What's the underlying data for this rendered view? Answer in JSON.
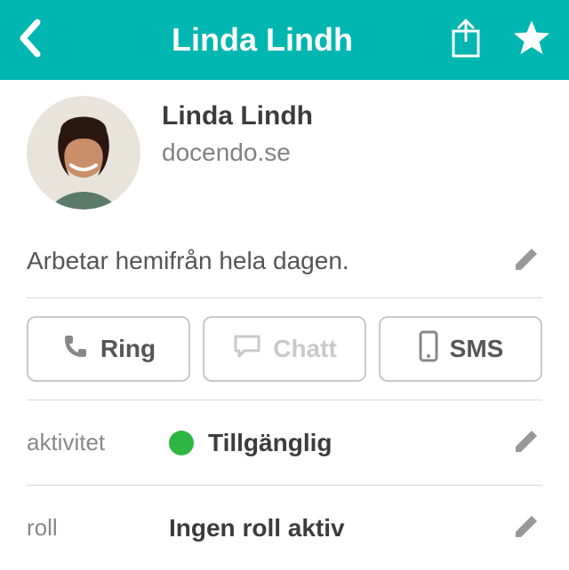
{
  "header": {
    "title": "Linda Lindh"
  },
  "profile": {
    "name": "Linda Lindh",
    "org": "docendo.se"
  },
  "status_message": "Arbetar hemifrån hela dagen.",
  "actions": {
    "call": "Ring",
    "chat": "Chatt",
    "sms": "SMS"
  },
  "fields": {
    "activity": {
      "label": "aktivitet",
      "value": "Tillgänglig",
      "dot_color": "#2db742"
    },
    "role": {
      "label": "roll",
      "value": "Ingen roll aktiv"
    }
  },
  "colors": {
    "header_bg": "#00b6b0",
    "edit_icon": "#989898"
  }
}
